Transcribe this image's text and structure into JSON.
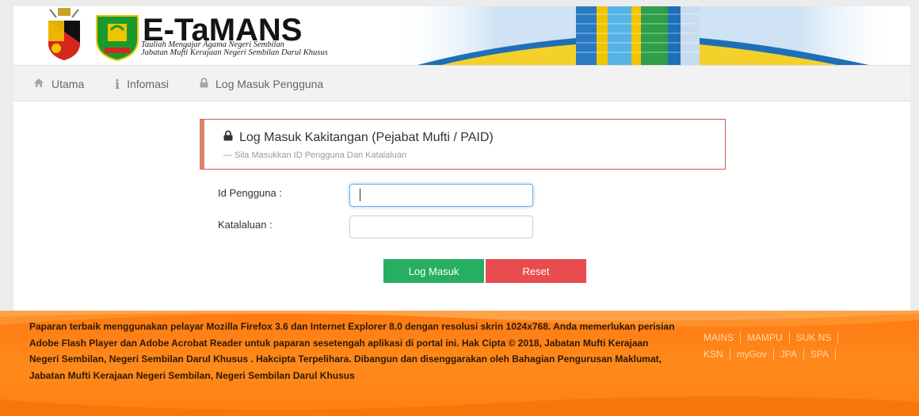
{
  "header": {
    "brand_title": "E-TaMANS",
    "brand_sub_line1": "Tauliah Mengajar Agama Negeri Sembilan",
    "brand_sub_line2": "Jabatan Mufti Kerajaan Negeri Sembilan Darul Khusus"
  },
  "nav": {
    "items": [
      {
        "label": "Utama",
        "icon": "home-icon"
      },
      {
        "label": "Infomasi",
        "icon": "info-icon"
      },
      {
        "label": "Log Masuk Pengguna",
        "icon": "lock-icon"
      }
    ]
  },
  "login": {
    "title": "Log Masuk Kakitangan (Pejabat Mufti / PAID)",
    "subtitle": "— Sila Masukkan ID Pengguna Dan Katalaluan",
    "username_label": "Id Pengguna :",
    "username_value": "",
    "password_label": "Katalaluan :",
    "password_value": "",
    "login_button": "Log Masuk",
    "reset_button": "Reset"
  },
  "footer": {
    "text": "Paparan terbaik menggunakan pelayar Mozilla Firefox 3.6 dan Internet Explorer 8.0 dengan resolusi skrin 1024x768. Anda memerlukan perisian Adobe Flash Player dan Adobe Acrobat Reader untuk paparan sesetengah aplikasi di portal ini. Hak Cipta © 2018, Jabatan Mufti Kerajaan Negeri Sembilan, Negeri Sembilan Darul Khusus . Hakcipta Terpelihara. Dibangun dan disenggarakan oleh Bahagian Pengurusan Maklumat, Jabatan Mufti Kerajaan Negeri Sembilan, Negeri Sembilan Darul Khusus",
    "links_row1": [
      "MAINS",
      "MAMPU",
      "SUK NS"
    ],
    "links_row2": [
      "KSN",
      "myGov",
      "JPA",
      "SPA"
    ]
  },
  "colors": {
    "login_green": "#27ae60",
    "reset_red": "#e84c4f",
    "footer_orange": "#ff7f10",
    "panel_border": "#d9534f"
  }
}
